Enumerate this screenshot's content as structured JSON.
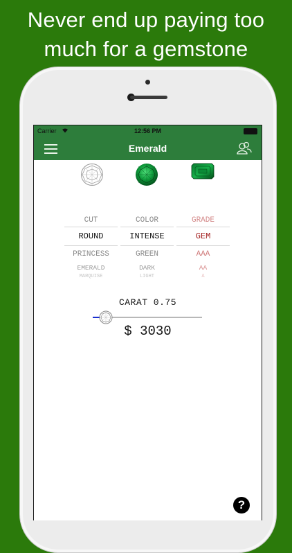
{
  "promo": {
    "headline_line1": "Never end up paying too",
    "headline_line2": "much for a gemstone"
  },
  "status_bar": {
    "carrier": "Carrier",
    "time": "12:56 PM"
  },
  "nav": {
    "title": "Emerald",
    "left_icon": "menu-icon",
    "right_icon": "user-group-icon"
  },
  "gem_selector": {
    "icons": [
      "diamond-outline-icon",
      "round-emerald-icon",
      "emerald-cut-icon"
    ]
  },
  "picker": {
    "columns": [
      {
        "header": "CUT",
        "selected": "ROUND",
        "options_below": [
          "PRINCESS",
          "EMERALD",
          "MARQUISE"
        ]
      },
      {
        "header": "COLOR",
        "selected": "INTENSE",
        "options_below": [
          "GREEN",
          "DARK",
          "LIGHT"
        ]
      },
      {
        "header": "GRADE",
        "selected": "GEM",
        "options_below": [
          "AAA",
          "AA",
          "A"
        ]
      }
    ]
  },
  "carat": {
    "label": "CARAT 0.75",
    "slider_fraction": 0.12
  },
  "price": {
    "text": "$ 3030"
  },
  "help": {
    "label": "?"
  },
  "colors": {
    "background_green": "#2b7a0b",
    "navbar_green": "#2d7d3b",
    "grade_red": "#a31f1f",
    "slider_fill": "#1a2fd0"
  }
}
